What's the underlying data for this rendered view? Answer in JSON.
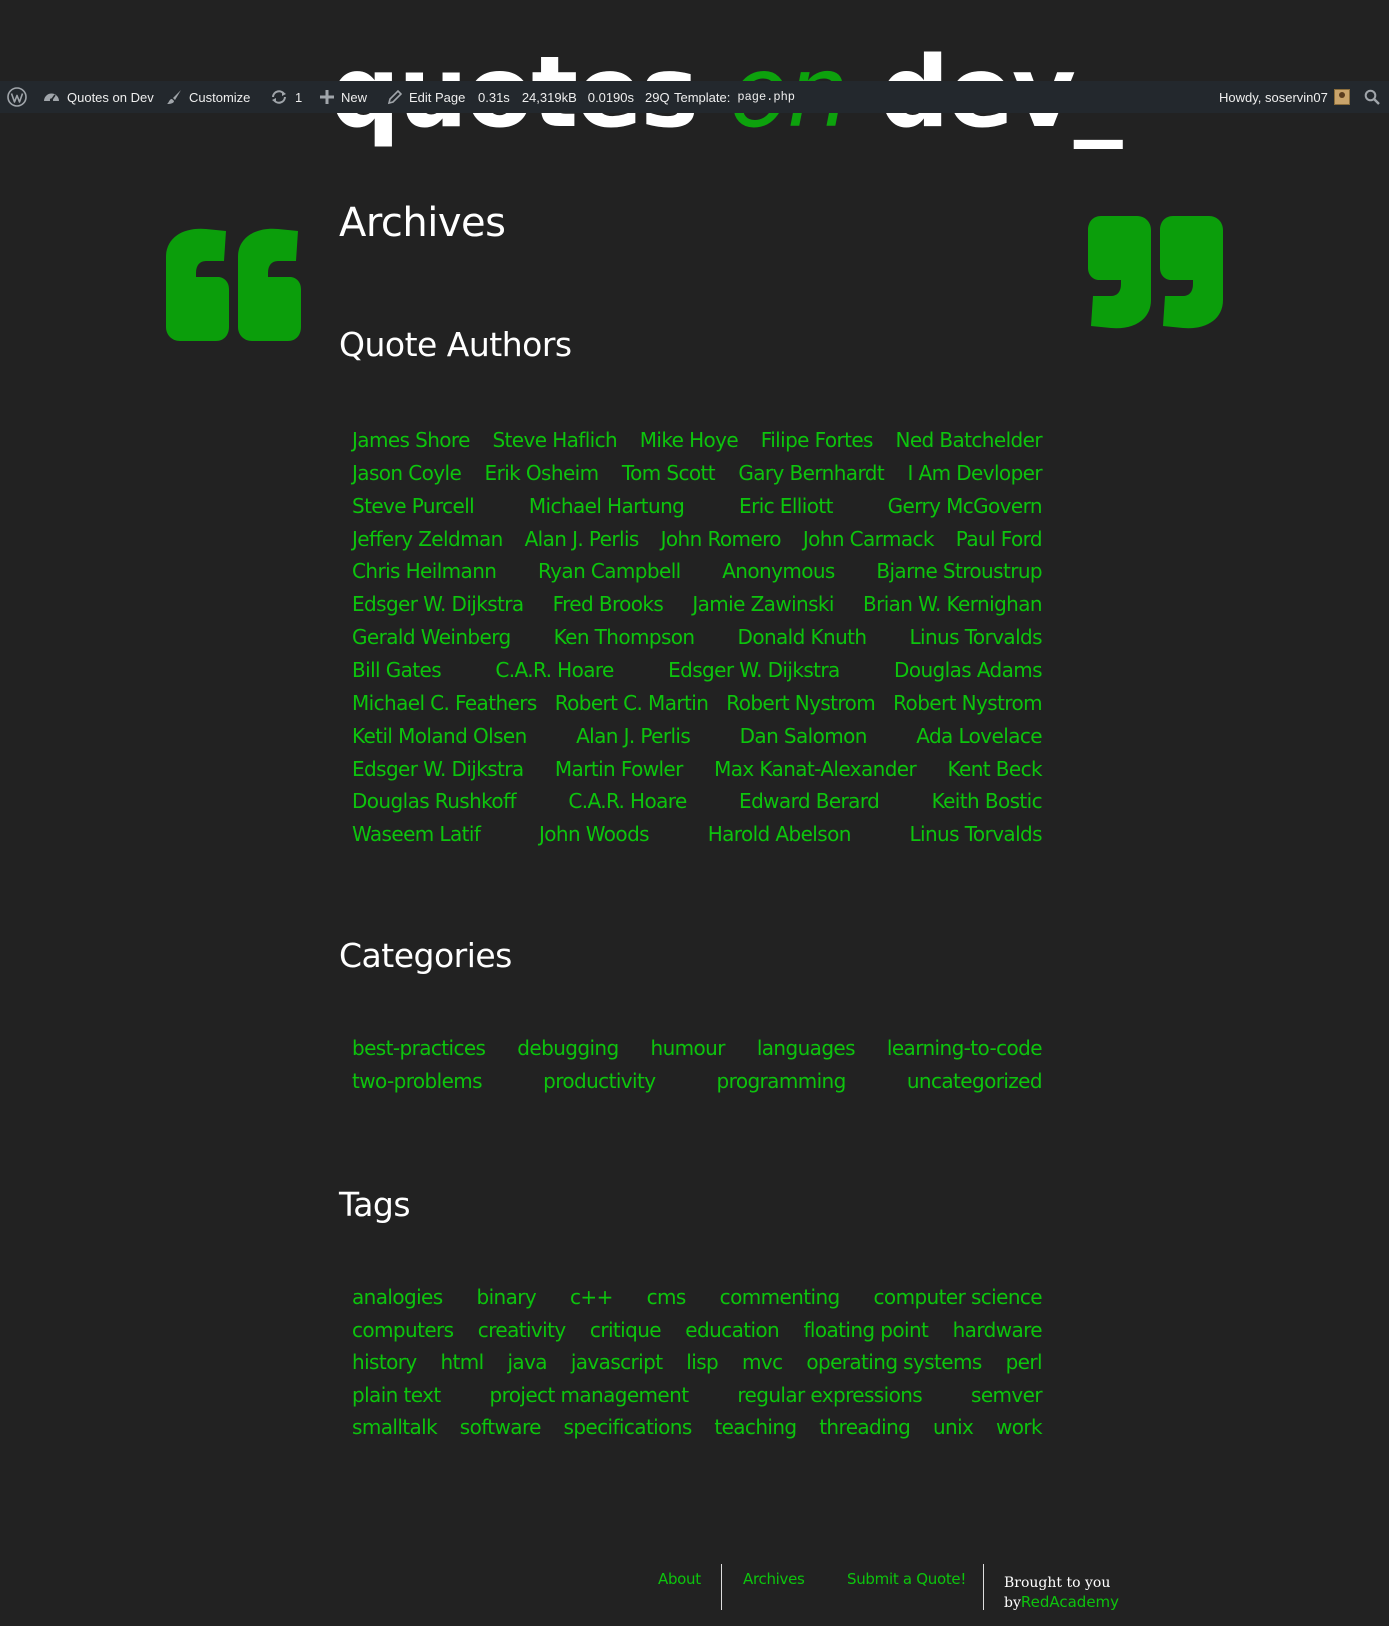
{
  "site": {
    "logo_part1": "quotes",
    "logo_part2": "on",
    "logo_part3": "dev_"
  },
  "adminbar": {
    "site_name": "Quotes on Dev",
    "customize": "Customize",
    "updates_count": "1",
    "new": "New",
    "edit_page": "Edit Page",
    "time": "0.31s",
    "memory": "24,319kB",
    "db_time": "0.0190s",
    "queries": "29Q",
    "template_label": "Template:",
    "template_value": "page.php",
    "howdy": "Howdy, soservin07"
  },
  "page": {
    "title": "Archives"
  },
  "authors": {
    "heading": "Quote Authors",
    "rows": [
      [
        "James Shore",
        "Steve Haflich",
        "Mike Hoye",
        "Filipe Fortes",
        "Ned Batchelder"
      ],
      [
        "Jason Coyle",
        "Erik Osheim",
        "Tom Scott",
        "Gary Bernhardt",
        "I Am Devloper"
      ],
      [
        "Steve Purcell",
        "Michael Hartung",
        "Eric Elliott",
        "Gerry McGovern"
      ],
      [
        "Jeffery Zeldman",
        "Alan J. Perlis",
        "John Romero",
        "John Carmack",
        "Paul Ford"
      ],
      [
        "Chris Heilmann",
        "Ryan Campbell",
        "Anonymous",
        "Bjarne Stroustrup"
      ],
      [
        "Edsger W. Dijkstra",
        "Fred Brooks",
        "Jamie Zawinski",
        "Brian W. Kernighan"
      ],
      [
        "Gerald Weinberg",
        "Ken Thompson",
        "Donald Knuth",
        "Linus Torvalds"
      ],
      [
        "Bill Gates",
        "C.A.R. Hoare",
        "Edsger W. Dijkstra",
        "Douglas Adams"
      ],
      [
        "Michael C. Feathers",
        "Robert C. Martin",
        "Robert Nystrom",
        "Robert Nystrom"
      ],
      [
        "Ketil Moland Olsen",
        "Alan J. Perlis",
        "Dan Salomon",
        "Ada Lovelace"
      ],
      [
        "Edsger W. Dijkstra",
        "Martin Fowler",
        "Max Kanat-Alexander",
        "Kent Beck"
      ],
      [
        "Douglas Rushkoff",
        "C.A.R. Hoare",
        "Edward Berard",
        "Keith Bostic"
      ],
      [
        "Waseem Latif",
        "John Woods",
        "Harold Abelson",
        "Linus Torvalds"
      ]
    ]
  },
  "categories": {
    "heading": "Categories",
    "rows": [
      [
        "best-practices",
        "debugging",
        "humour",
        "languages",
        "learning-to-code"
      ],
      [
        "two-problems",
        "productivity",
        "programming",
        "uncategorized"
      ]
    ]
  },
  "tags": {
    "heading": "Tags",
    "rows": [
      [
        "analogies",
        "binary",
        "c++",
        "cms",
        "commenting",
        "computer science"
      ],
      [
        "computers",
        "creativity",
        "critique",
        "education",
        "floating point",
        "hardware"
      ],
      [
        "history",
        "html",
        "java",
        "javascript",
        "lisp",
        "mvc",
        "operating systems",
        "perl"
      ],
      [
        "plain text",
        "project management",
        "regular expressions",
        "semver"
      ],
      [
        "smalltalk",
        "software",
        "specifications",
        "teaching",
        "threading",
        "unix",
        "work"
      ]
    ]
  },
  "footer": {
    "about": "About",
    "archives": "Archives",
    "submit": "Submit a Quote!",
    "credit_line1": "Brought to you",
    "credit_by": "by",
    "credit_link": "RedAcademy"
  },
  "colors": {
    "background": "#222222",
    "accent_green": "#0dc40d",
    "quote_green": "#0b9e0b",
    "adminbar": "#23282d"
  },
  "icons": {
    "wordpress": "wordpress-logo-icon",
    "dashboard": "dashboard-icon",
    "customize": "paintbrush-icon",
    "updates": "refresh-icon",
    "new": "plus-icon",
    "edit": "pencil-icon",
    "search": "search-icon",
    "open_quote": "open-quote-icon",
    "close_quote": "close-quote-icon"
  }
}
